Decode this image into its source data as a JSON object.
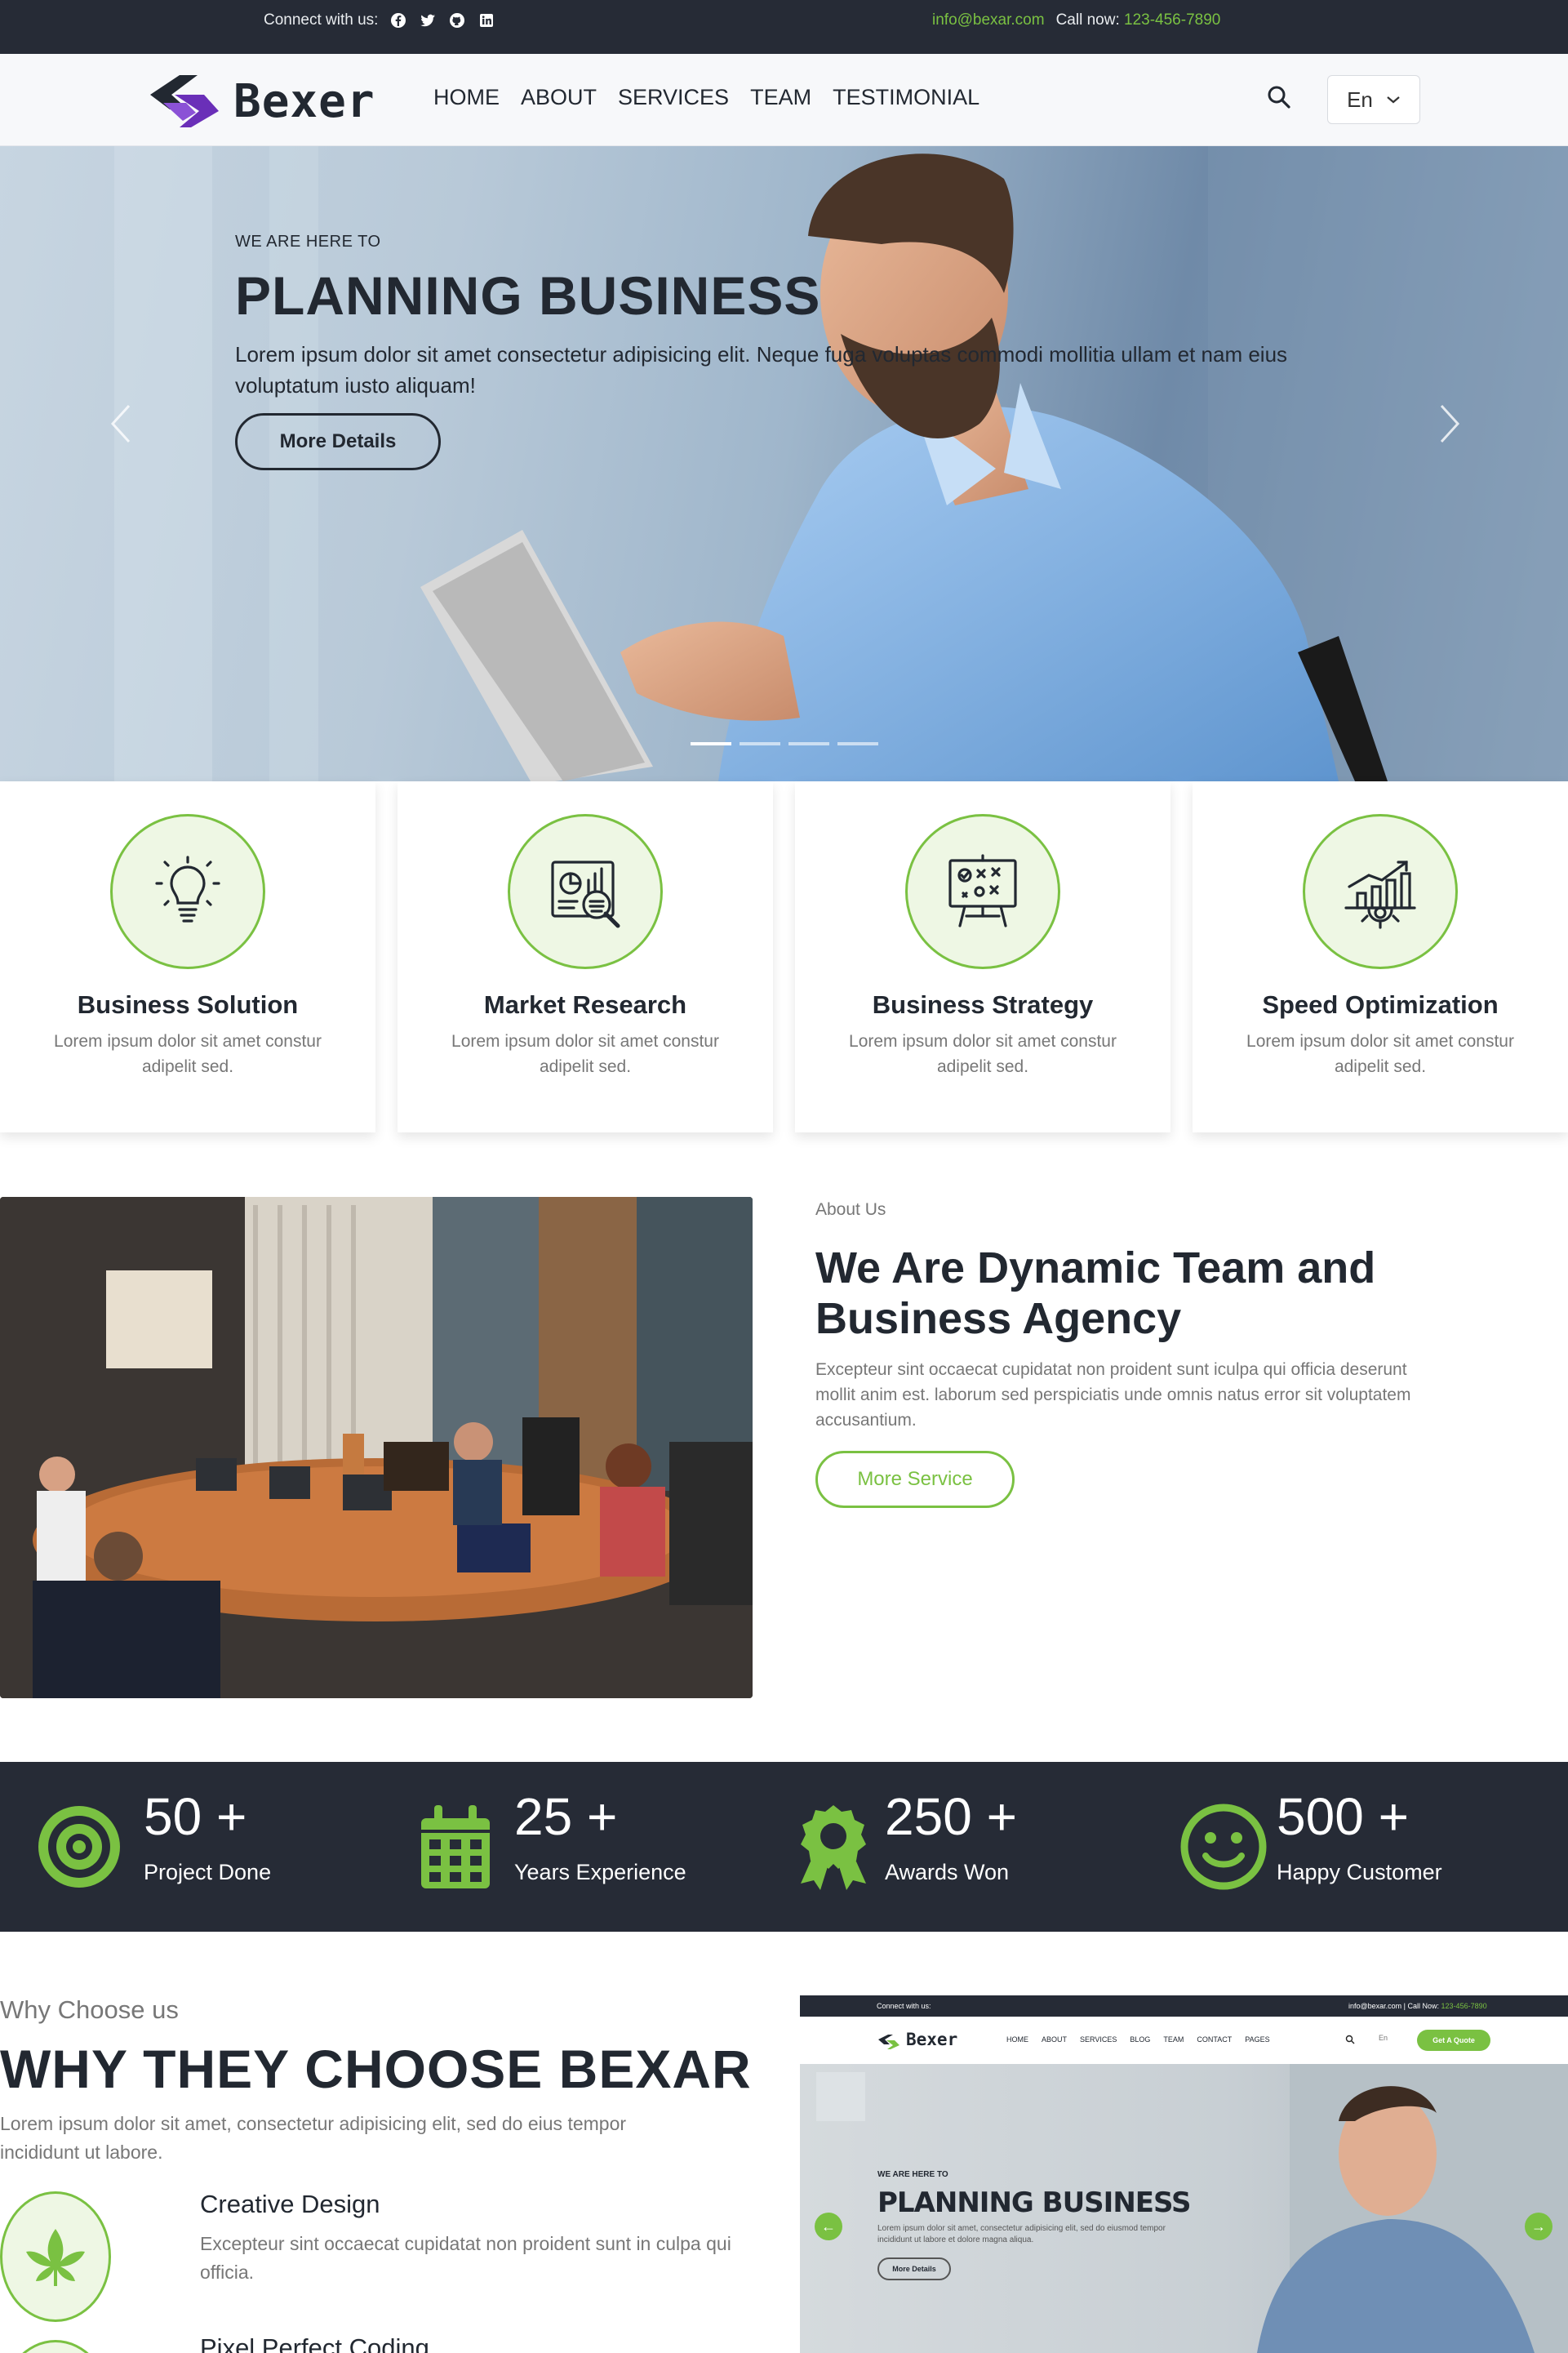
{
  "topbar": {
    "connect_label": "Connect with us:",
    "social_icons": [
      "facebook-icon",
      "twitter-icon",
      "github-icon",
      "linkedin-icon"
    ],
    "email": "info@bexar.com",
    "call_label": "Call now:",
    "phone": "123-456-7890"
  },
  "navbar": {
    "logo_text": "Bexer",
    "items": [
      "HOME",
      "ABOUT",
      "SERVICES",
      "TEAM",
      "TESTIMONIAL"
    ],
    "language": "En"
  },
  "hero": {
    "kicker": "WE ARE HERE TO",
    "title": "PLANNING BUSINESS",
    "text": "Lorem ipsum dolor sit amet consectetur adipisicing elit. Neque fuga voluptas commodi mollitia ullam et nam eius voluptatum iusto aliquam!",
    "button": "More Details",
    "slides_total": 4,
    "active_slide": 1
  },
  "services": [
    {
      "title": "Business Solution",
      "desc": "Lorem ipsum dolor sit amet constur adipelit sed.",
      "icon": "lightbulb-icon"
    },
    {
      "title": "Market Research",
      "desc": "Lorem ipsum dolor sit amet constur adipelit sed.",
      "icon": "market-research-icon"
    },
    {
      "title": "Business Strategy",
      "desc": "Lorem ipsum dolor sit amet constur adipelit sed.",
      "icon": "strategy-board-icon"
    },
    {
      "title": "Speed Optimization",
      "desc": "Lorem ipsum dolor sit amet constur adipelit sed.",
      "icon": "growth-chart-icon"
    }
  ],
  "about": {
    "kicker": "About Us",
    "title": "We Are Dynamic Team and Business Agency",
    "text": "Excepteur sint occaecat cupidatat non proident sunt iculpa qui officia deserunt mollit anim est. laborum sed perspiciatis unde omnis natus error sit voluptatem accusantium.",
    "button": "More Service"
  },
  "stats": [
    {
      "number": "50 +",
      "label": "Project Done",
      "icon": "target-icon"
    },
    {
      "number": "25 +",
      "label": "Years Experience",
      "icon": "calendar-icon"
    },
    {
      "number": "250 +",
      "label": "Awards Won",
      "icon": "award-icon"
    },
    {
      "number": "500 +",
      "label": "Happy Customer",
      "icon": "smile-icon"
    }
  ],
  "why": {
    "kicker": "Why Choose us",
    "title": "WHY THEY CHOOSE BEXAR",
    "text": "Lorem ipsum dolor sit amet, consectetur adipisicing elit, sed do eius tempor incididunt ut labore.",
    "features": [
      {
        "title": "Creative Design",
        "text": "Excepteur sint occaecat cupidatat non proident sunt in culpa qui officia.",
        "icon": "leaf-icon"
      },
      {
        "title": "Pixel Perfect Coding",
        "text": "",
        "icon": "code-icon"
      }
    ]
  },
  "preview": {
    "connect_label": "Connect with us:",
    "email": "info@bexar.com",
    "call_label": "Call Now:",
    "phone": "123-456-7890",
    "logo_text": "Bexer",
    "nav": [
      "HOME",
      "ABOUT",
      "SERVICES",
      "BLOG",
      "TEAM",
      "CONTACT",
      "PAGES"
    ],
    "language": "En",
    "quote_button": "Get A Quote",
    "kicker": "WE ARE HERE TO",
    "title": "PLANNING BUSINESS",
    "text": "Lorem ipsum dolor sit amet, consectetur adipisicing elit, sed do eiusmod tempor incididunt ut labore et dolore magna aliqua.",
    "button": "More Details"
  },
  "colors": {
    "accent": "#7ac142",
    "dark": "#262b36",
    "text": "#222831",
    "muted": "#777777",
    "logo_purple": "#6a2fb8"
  }
}
